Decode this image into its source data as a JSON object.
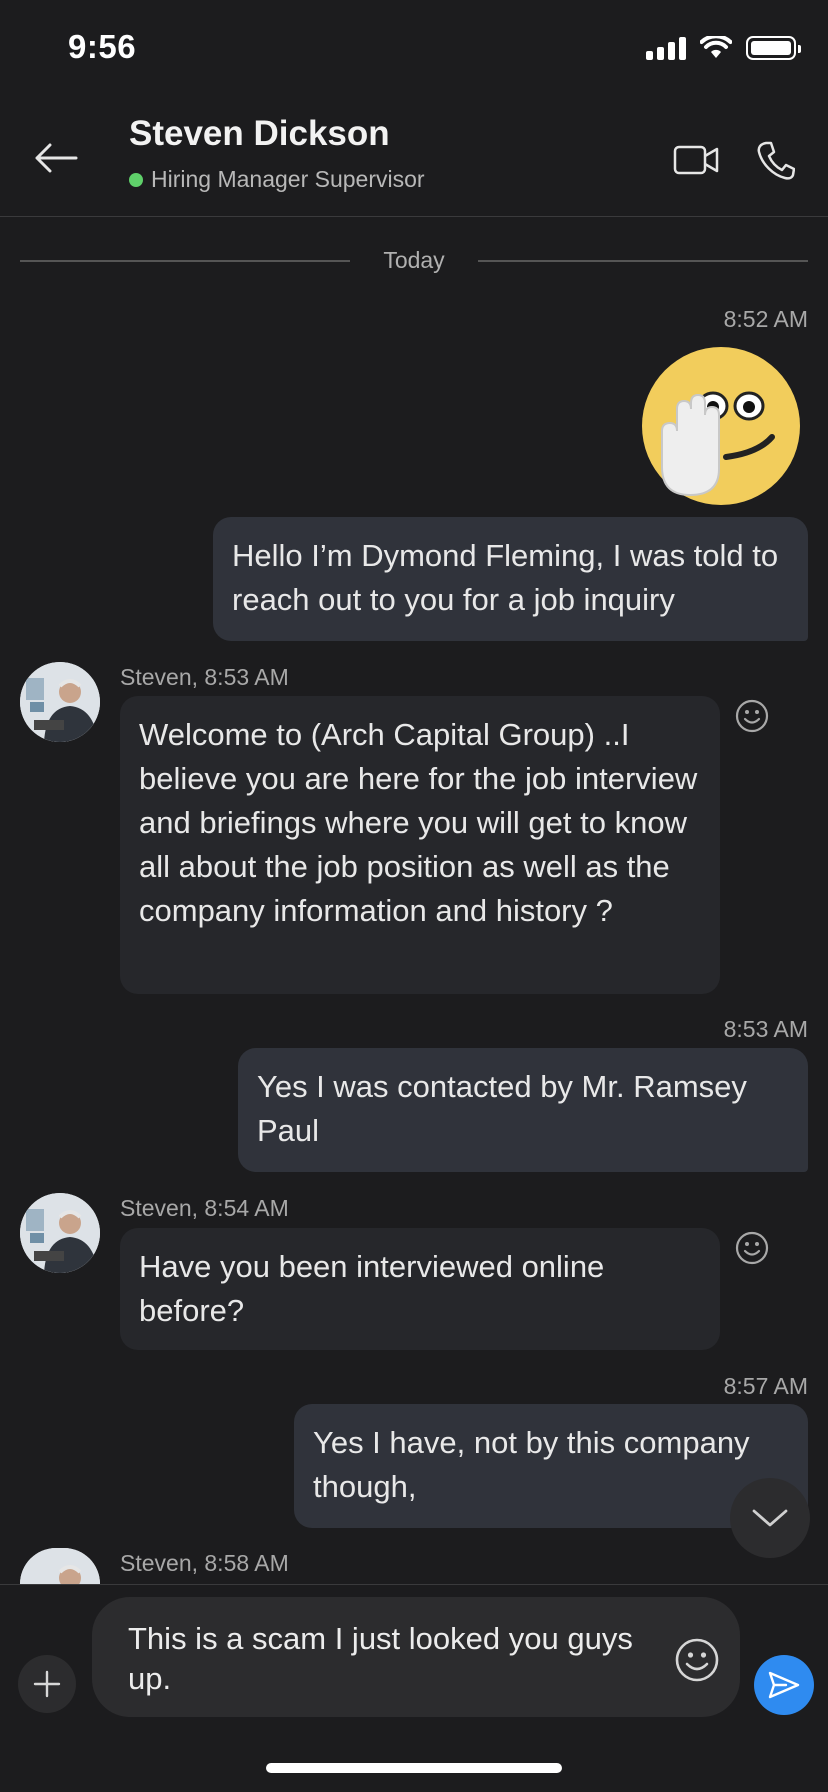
{
  "status_bar": {
    "time": "9:56"
  },
  "header": {
    "contact_name": "Steven Dickson",
    "contact_title": "Hiring Manager Supervisor",
    "presence_color": "#5fd06a"
  },
  "conversation": {
    "date_divider": "Today",
    "messages": [
      {
        "direction": "outgoing",
        "timestamp": "8:52 AM",
        "sticker": "waving-emoji",
        "text": "Hello I’m Dymond Fleming, I was told to reach out to you for a job inquiry"
      },
      {
        "direction": "incoming",
        "sender_line": "Steven, 8:53 AM",
        "text": "Welcome to (Arch Capital Group) ..I believe you are here for the job interview and briefings where you will get to know all about the job position as well as the company information and history ?"
      },
      {
        "direction": "outgoing",
        "timestamp": "8:53 AM",
        "text": "Yes I was contacted by Mr. Ramsey Paul"
      },
      {
        "direction": "incoming",
        "sender_line": "Steven, 8:54 AM",
        "text": "Have you been interviewed online before?"
      },
      {
        "direction": "outgoing",
        "timestamp": "8:57 AM",
        "text": "Yes I have, not by this company though,"
      },
      {
        "direction": "incoming",
        "sender_line": "Steven, 8:58 AM",
        "text": ""
      }
    ]
  },
  "composer": {
    "draft_text": "This is a scam I just looked you guys up.",
    "send_button_color": "#2f8bf0"
  },
  "icons": [
    "back-arrow-icon",
    "video-camera-icon",
    "phone-icon",
    "smiley-icon",
    "chevron-down-icon",
    "plus-icon",
    "send-icon"
  ]
}
